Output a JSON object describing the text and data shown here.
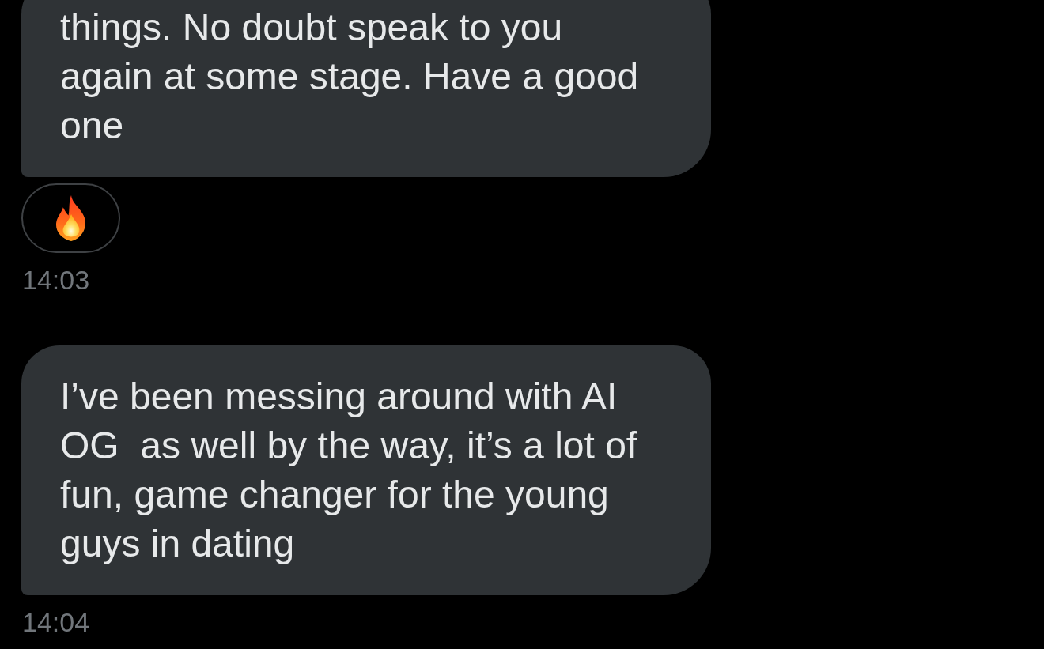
{
  "messages": [
    {
      "text": "things. No doubt speak to you again at some stage. Have a good one",
      "reactions": [
        {
          "kind": "fire"
        }
      ],
      "time": "14:03"
    },
    {
      "text": "I’ve been messing around with AI OG  as well by the way, it’s a lot of fun, game changer for the young guys in dating",
      "time": "14:04"
    }
  ]
}
